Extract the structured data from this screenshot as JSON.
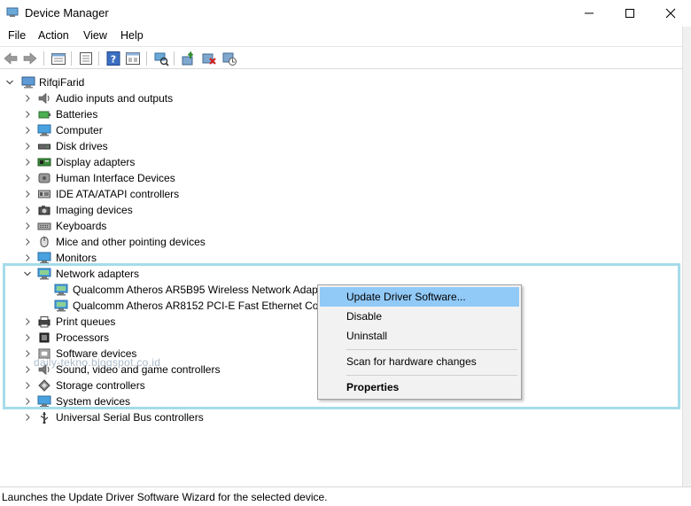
{
  "window": {
    "title": "Device Manager"
  },
  "menu": [
    "File",
    "Action",
    "View",
    "Help"
  ],
  "toolbar": {
    "icons": [
      "back-arrow-icon",
      "forward-arrow-icon",
      "properties-sheet-icon",
      "console-tree-icon",
      "help-icon",
      "view-icon",
      "scan-hardware-icon",
      "update-driver-icon",
      "uninstall-device-icon",
      "disable-device-icon"
    ]
  },
  "tree": {
    "root": "RifqiFarid",
    "categories": [
      "Audio inputs and outputs",
      "Batteries",
      "Computer",
      "Disk drives",
      "Display adapters",
      "Human Interface Devices",
      "IDE ATA/ATAPI controllers",
      "Imaging devices",
      "Keyboards",
      "Mice and other pointing devices",
      "Monitors",
      "Network adapters",
      "Print queues",
      "Processors",
      "Software devices",
      "Sound, video and game controllers",
      "Storage controllers",
      "System devices",
      "Universal Serial Bus controllers"
    ],
    "network_children": [
      "Qualcomm Atheros AR5B95 Wireless Network Adapt",
      "Qualcomm Atheros AR8152 PCI-E Fast Ethernet Con"
    ]
  },
  "context_menu": {
    "items": [
      "Update Driver Software...",
      "Disable",
      "Uninstall",
      "Scan for hardware changes",
      "Properties"
    ]
  },
  "watermark": "daily-tekno.blogspot.co.id",
  "status": "Launches the Update Driver Software Wizard for the selected device.",
  "colors": {
    "highlight_border": "#a6dbe9",
    "menu_active": "#91c9f7"
  }
}
